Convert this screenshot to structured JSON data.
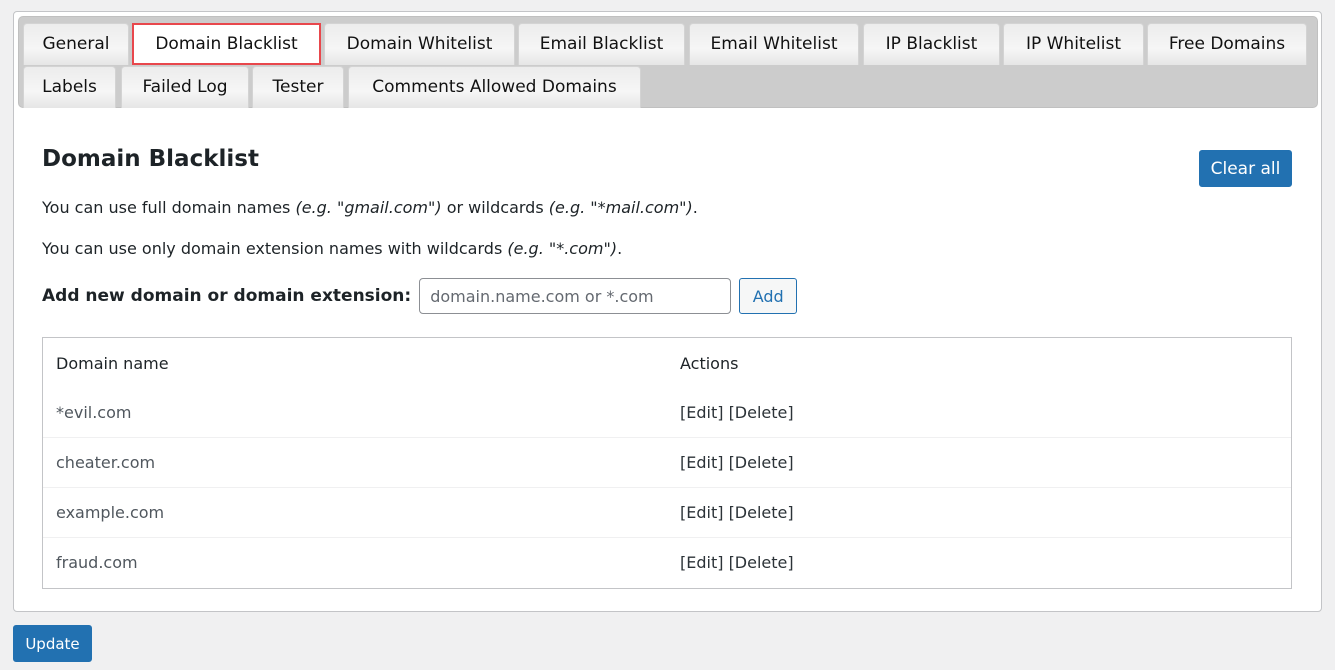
{
  "tabs": [
    {
      "label": "General",
      "active": false
    },
    {
      "label": "Domain Blacklist",
      "active": true
    },
    {
      "label": "Domain Whitelist",
      "active": false
    },
    {
      "label": "Email Blacklist",
      "active": false
    },
    {
      "label": "Email Whitelist",
      "active": false
    },
    {
      "label": "IP Blacklist",
      "active": false
    },
    {
      "label": "IP Whitelist",
      "active": false
    },
    {
      "label": "Free Domains",
      "active": false
    },
    {
      "label": "Labels",
      "active": false
    },
    {
      "label": "Failed Log",
      "active": false
    },
    {
      "label": "Tester",
      "active": false
    },
    {
      "label": "Comments Allowed Domains",
      "active": false
    }
  ],
  "section": {
    "title": "Domain Blacklist",
    "clear_all_label": "Clear all",
    "desc1": {
      "part1": "You can use full domain names ",
      "example1": "(e.g. \"gmail.com\")",
      "part2": " or wildcards ",
      "example2": "(e.g. \"*mail.com\")",
      "part3": "."
    },
    "desc2": {
      "part1": "You can use only domain extension names with wildcards ",
      "example1": "(e.g. \"*.com\")",
      "part2": "."
    },
    "add_label": "Add new domain or domain extension:",
    "add_placeholder": "domain.name.com or *.com",
    "add_value": "",
    "add_button_label": "Add"
  },
  "table": {
    "columns": [
      "Domain name",
      "Actions"
    ],
    "rows": [
      {
        "domain": "*evil.com",
        "edit": "[Edit]",
        "delete": "[Delete]"
      },
      {
        "domain": "cheater.com",
        "edit": "[Edit]",
        "delete": "[Delete]"
      },
      {
        "domain": "example.com",
        "edit": "[Edit]",
        "delete": "[Delete]"
      },
      {
        "domain": "fraud.com",
        "edit": "[Edit]",
        "delete": "[Delete]"
      }
    ]
  },
  "footer": {
    "update_label": "Update"
  },
  "colors": {
    "primary": "#2271b1",
    "active_tab_border": "#e8474c",
    "page_bg": "#f0f0f1",
    "tabbar_bg": "#cccccc"
  }
}
